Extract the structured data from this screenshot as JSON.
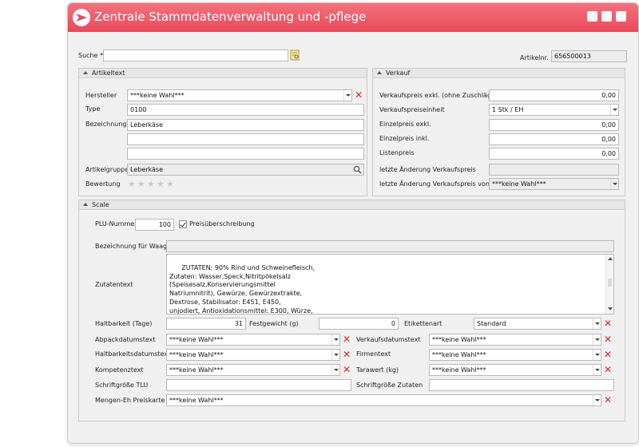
{
  "window": {
    "title": "Zentrale Stammdatenverwaltung und -pflege"
  },
  "search": {
    "label": "Suche *",
    "value": ""
  },
  "artikelnr": {
    "label": "Artikelnr.",
    "value": "656500013"
  },
  "artikeltext": {
    "title": "Artikeltext",
    "hersteller_label": "Hersteller",
    "hersteller_value": "***keine Wahl***",
    "type_label": "Type",
    "type_value": "0100",
    "bezeichnung_label": "Bezeichnung",
    "bezeichnung_values": [
      "Leberkäse",
      "",
      ""
    ],
    "artikelgruppe_label": "Artikelgruppe",
    "artikelgruppe_value": "Leberkäse",
    "bewertung_label": "Bewertung",
    "bewertung_value": 0,
    "bewertung_max": 5
  },
  "verkauf": {
    "title": "Verkauf",
    "rows": [
      {
        "label": "Verkaufspreis exkl. (ohne Zuschläge)",
        "value": "0,00"
      },
      {
        "label": "Verkaufspreiseinheit",
        "value": "1 Stk / EH"
      },
      {
        "label": "Einzelpreis exkl.",
        "value": "0,00"
      },
      {
        "label": "Einzelpreis inkl.",
        "value": "0,00"
      },
      {
        "label": "Listenpreis",
        "value": "0,00"
      },
      {
        "label": "letzte Änderung Verkaufspreis",
        "value": ""
      },
      {
        "label": "letzte Änderung Verkaufspreis von",
        "value": "***keine Wahl***"
      }
    ]
  },
  "scale": {
    "title": "Scale",
    "plu_label": "PLU-Nummer",
    "plu_value": "100",
    "preisueberschreibung_label": "Preisüberschreibung",
    "preisueberschreibung_checked": true,
    "bezeichnung_waage_label": "Bezeichnung für Waage",
    "bezeichnung_waage_value": "",
    "zutatentext_label": "Zutatentext",
    "zutatentext_value": "ZUTATEN: 90% Rind und Schweinefleisch,\nZutaten: Wasser,Speck,Nitritpökelsalz\n(Speisesalz,Konservierungsmittel\nNatriumnitrit), Gewürze, Gewürzextrakte,\nDextrose, Stabilisator: E451, E450,\nunjodiert, Antioxidationsmittel: E300, Würze,\nAroma.",
    "haltbarkeit_label": "Haltbarkeit (Tage)",
    "haltbarkeit_value": "31",
    "festgewicht_label": "Festgewicht (g)",
    "festgewicht_value": "0",
    "etikettenart_label": "Etikettenart",
    "etikettenart_value": "Standard",
    "abpackdatumstext_label": "Abpackdatumstext",
    "abpackdatumstext_value": "***keine Wahl***",
    "verkaufsdatumstext_label": "Verkaufsdatumstext",
    "verkaufsdatumstext_value": "***keine Wahl***",
    "haltbarkeitsdatumstext_label": "Haltbarkeitsdatumstext",
    "haltbarkeitsdatumstext_value": "***keine Wahl***",
    "firmentext_label": "Firmentext",
    "firmentext_value": "***keine Wahl***",
    "kompetenztext_label": "Kompetenztext",
    "kompetenztext_value": "***keine Wahl***",
    "tarawert_label": "Tarawert (kg)",
    "tarawert_value": "***keine Wahl***",
    "schriftgroesse_tlu_label": "Schriftgröße TLU",
    "schriftgroesse_tlu_value": "",
    "schriftgroesse_zutaten_label": "Schriftgröße Zutaten",
    "schriftgroesse_zutaten_value": "",
    "mengen_eh_label": "Mengen-Eh Preiskarte",
    "mengen_eh_value": "***keine Wahl***"
  },
  "colors": {
    "titlebar": "#ee5b69",
    "clear": "#d8281f"
  },
  "icons": {
    "logo": "arrow-logo-icon",
    "search": "notepad-search-icon",
    "magnifier": "magnifier-icon",
    "clear": "red-x-icon",
    "star": "star-icon"
  }
}
